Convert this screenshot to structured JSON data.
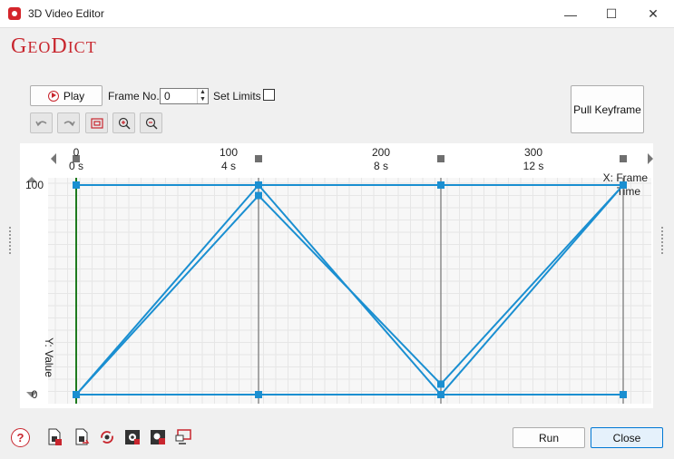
{
  "window": {
    "title": "3D Video Editor",
    "min_glyph": "—",
    "max_glyph": "☐",
    "close_glyph": "✕"
  },
  "logo": {
    "part1_big": "G",
    "part1_small": "EO",
    "part2_big": "D",
    "part2_small": "ICT"
  },
  "controls": {
    "play_label": "Play",
    "frame_label": "Frame No.",
    "frame_value": "0",
    "set_limits_label": "Set Limits",
    "set_limits_checked": false,
    "pull_keyframe_label": "Pull Keyframe"
  },
  "toolbar": [
    "undo-icon",
    "redo-icon",
    "fit-view-icon",
    "zoom-in-icon",
    "zoom-out-icon"
  ],
  "chart_data": {
    "type": "line",
    "x_axis_top_labels": [
      {
        "frame": "0",
        "time": "0 s"
      },
      {
        "frame": "100",
        "time": "4 s"
      },
      {
        "frame": "200",
        "time": "8 s"
      },
      {
        "frame": "300",
        "time": "12 s"
      }
    ],
    "xlabel": [
      "X: Frame",
      "Time"
    ],
    "ylabel": "Y: Value",
    "y_ticks": [
      "100",
      "0"
    ],
    "xlim": [
      0,
      400
    ],
    "ylim": [
      0,
      100
    ],
    "keyframes_x": [
      0,
      120,
      240,
      360
    ],
    "series": [
      {
        "points": [
          [
            0,
            100
          ],
          [
            120,
            100
          ],
          [
            240,
            100
          ],
          [
            360,
            100
          ]
        ]
      },
      {
        "points": [
          [
            0,
            0
          ],
          [
            120,
            0
          ],
          [
            240,
            0
          ],
          [
            360,
            0
          ]
        ]
      },
      {
        "points": [
          [
            0,
            0
          ],
          [
            120,
            100
          ],
          [
            240,
            0
          ],
          [
            360,
            100
          ]
        ]
      },
      {
        "points": [
          [
            0,
            0
          ],
          [
            120,
            95
          ],
          [
            240,
            5
          ],
          [
            360,
            100
          ]
        ]
      }
    ],
    "line_color": "#1a8fd1",
    "grid": true
  },
  "bottom_icons": [
    "add-file-icon",
    "export-file-icon",
    "refresh-icon",
    "settings-icon",
    "run-settings-icon",
    "screen-share-icon"
  ],
  "footer": {
    "help_glyph": "?",
    "run_label": "Run",
    "close_label": "Close"
  }
}
